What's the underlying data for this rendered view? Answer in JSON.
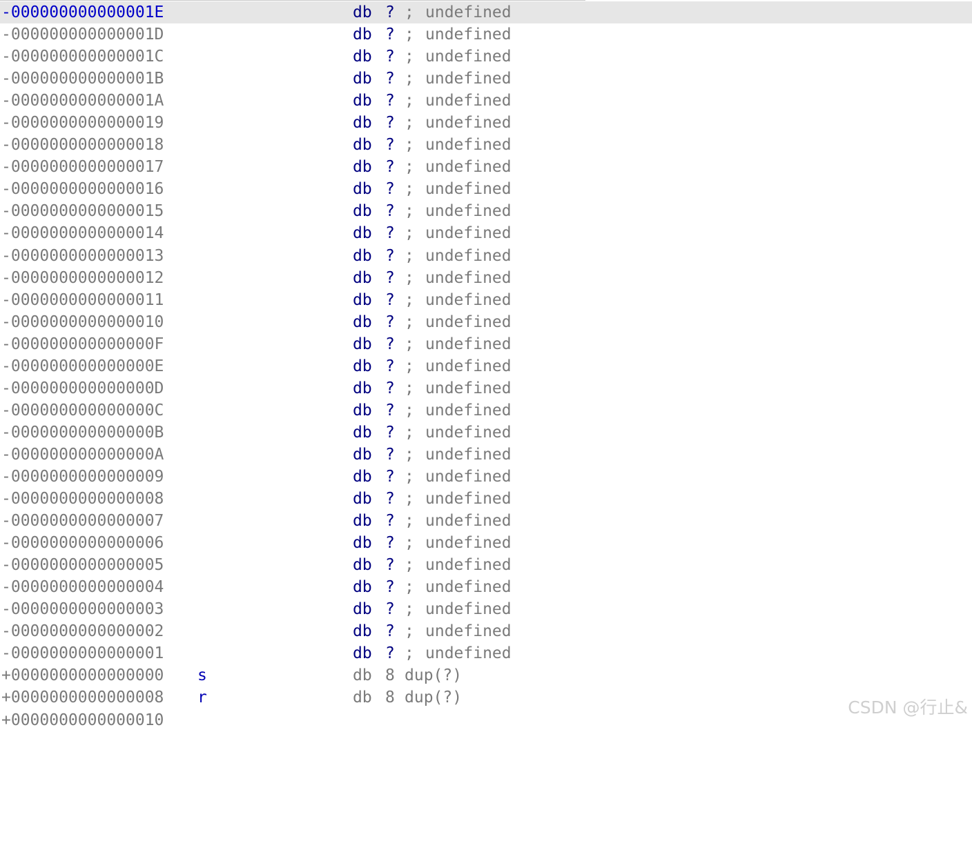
{
  "colors": {
    "offset": "#7a7a7a",
    "selected_offset": "#0000c8",
    "keyword": "#000080",
    "comment": "#7a7a7a",
    "selection_bg": "#e6e6e6",
    "member_name": "#0000b4"
  },
  "rows": [
    {
      "offset": "-000000000000001E",
      "kw": "db",
      "val": "?",
      "semi": ";",
      "comment": "undefined"
    },
    {
      "offset": "-000000000000001D",
      "kw": "db",
      "val": "?",
      "semi": ";",
      "comment": "undefined"
    },
    {
      "offset": "-000000000000001C",
      "kw": "db",
      "val": "?",
      "semi": ";",
      "comment": "undefined"
    },
    {
      "offset": "-000000000000001B",
      "kw": "db",
      "val": "?",
      "semi": ";",
      "comment": "undefined"
    },
    {
      "offset": "-000000000000001A",
      "kw": "db",
      "val": "?",
      "semi": ";",
      "comment": "undefined"
    },
    {
      "offset": "-0000000000000019",
      "kw": "db",
      "val": "?",
      "semi": ";",
      "comment": "undefined"
    },
    {
      "offset": "-0000000000000018",
      "kw": "db",
      "val": "?",
      "semi": ";",
      "comment": "undefined"
    },
    {
      "offset": "-0000000000000017",
      "kw": "db",
      "val": "?",
      "semi": ";",
      "comment": "undefined"
    },
    {
      "offset": "-0000000000000016",
      "kw": "db",
      "val": "?",
      "semi": ";",
      "comment": "undefined"
    },
    {
      "offset": "-0000000000000015",
      "kw": "db",
      "val": "?",
      "semi": ";",
      "comment": "undefined"
    },
    {
      "offset": "-0000000000000014",
      "kw": "db",
      "val": "?",
      "semi": ";",
      "comment": "undefined"
    },
    {
      "offset": "-0000000000000013",
      "kw": "db",
      "val": "?",
      "semi": ";",
      "comment": "undefined"
    },
    {
      "offset": "-0000000000000012",
      "kw": "db",
      "val": "?",
      "semi": ";",
      "comment": "undefined"
    },
    {
      "offset": "-0000000000000011",
      "kw": "db",
      "val": "?",
      "semi": ";",
      "comment": "undefined"
    },
    {
      "offset": "-0000000000000010",
      "kw": "db",
      "val": "?",
      "semi": ";",
      "comment": "undefined"
    },
    {
      "offset": "-000000000000000F",
      "kw": "db",
      "val": "?",
      "semi": ";",
      "comment": "undefined"
    },
    {
      "offset": "-000000000000000E",
      "kw": "db",
      "val": "?",
      "semi": ";",
      "comment": "undefined"
    },
    {
      "offset": "-000000000000000D",
      "kw": "db",
      "val": "?",
      "semi": ";",
      "comment": "undefined"
    },
    {
      "offset": "-000000000000000C",
      "kw": "db",
      "val": "?",
      "semi": ";",
      "comment": "undefined"
    },
    {
      "offset": "-000000000000000B",
      "kw": "db",
      "val": "?",
      "semi": ";",
      "comment": "undefined"
    },
    {
      "offset": "-000000000000000A",
      "kw": "db",
      "val": "?",
      "semi": ";",
      "comment": "undefined"
    },
    {
      "offset": "-0000000000000009",
      "kw": "db",
      "val": "?",
      "semi": ";",
      "comment": "undefined"
    },
    {
      "offset": "-0000000000000008",
      "kw": "db",
      "val": "?",
      "semi": ";",
      "comment": "undefined"
    },
    {
      "offset": "-0000000000000007",
      "kw": "db",
      "val": "?",
      "semi": ";",
      "comment": "undefined"
    },
    {
      "offset": "-0000000000000006",
      "kw": "db",
      "val": "?",
      "semi": ";",
      "comment": "undefined"
    },
    {
      "offset": "-0000000000000005",
      "kw": "db",
      "val": "?",
      "semi": ";",
      "comment": "undefined"
    },
    {
      "offset": "-0000000000000004",
      "kw": "db",
      "val": "?",
      "semi": ";",
      "comment": "undefined"
    },
    {
      "offset": "-0000000000000003",
      "kw": "db",
      "val": "?",
      "semi": ";",
      "comment": "undefined"
    },
    {
      "offset": "-0000000000000002",
      "kw": "db",
      "val": "?",
      "semi": ";",
      "comment": "undefined"
    },
    {
      "offset": "-0000000000000001",
      "kw": "db",
      "val": "?",
      "semi": ";",
      "comment": "undefined"
    },
    {
      "offset": "+0000000000000000",
      "name": "s",
      "kw": "db",
      "val": "8",
      "dup": "dup(?)"
    },
    {
      "offset": "+0000000000000008",
      "name": "r",
      "kw": "db",
      "val": "8",
      "dup": "dup(?)"
    },
    {
      "offset": "+0000000000000010"
    }
  ],
  "watermark": "CSDN @行止&"
}
